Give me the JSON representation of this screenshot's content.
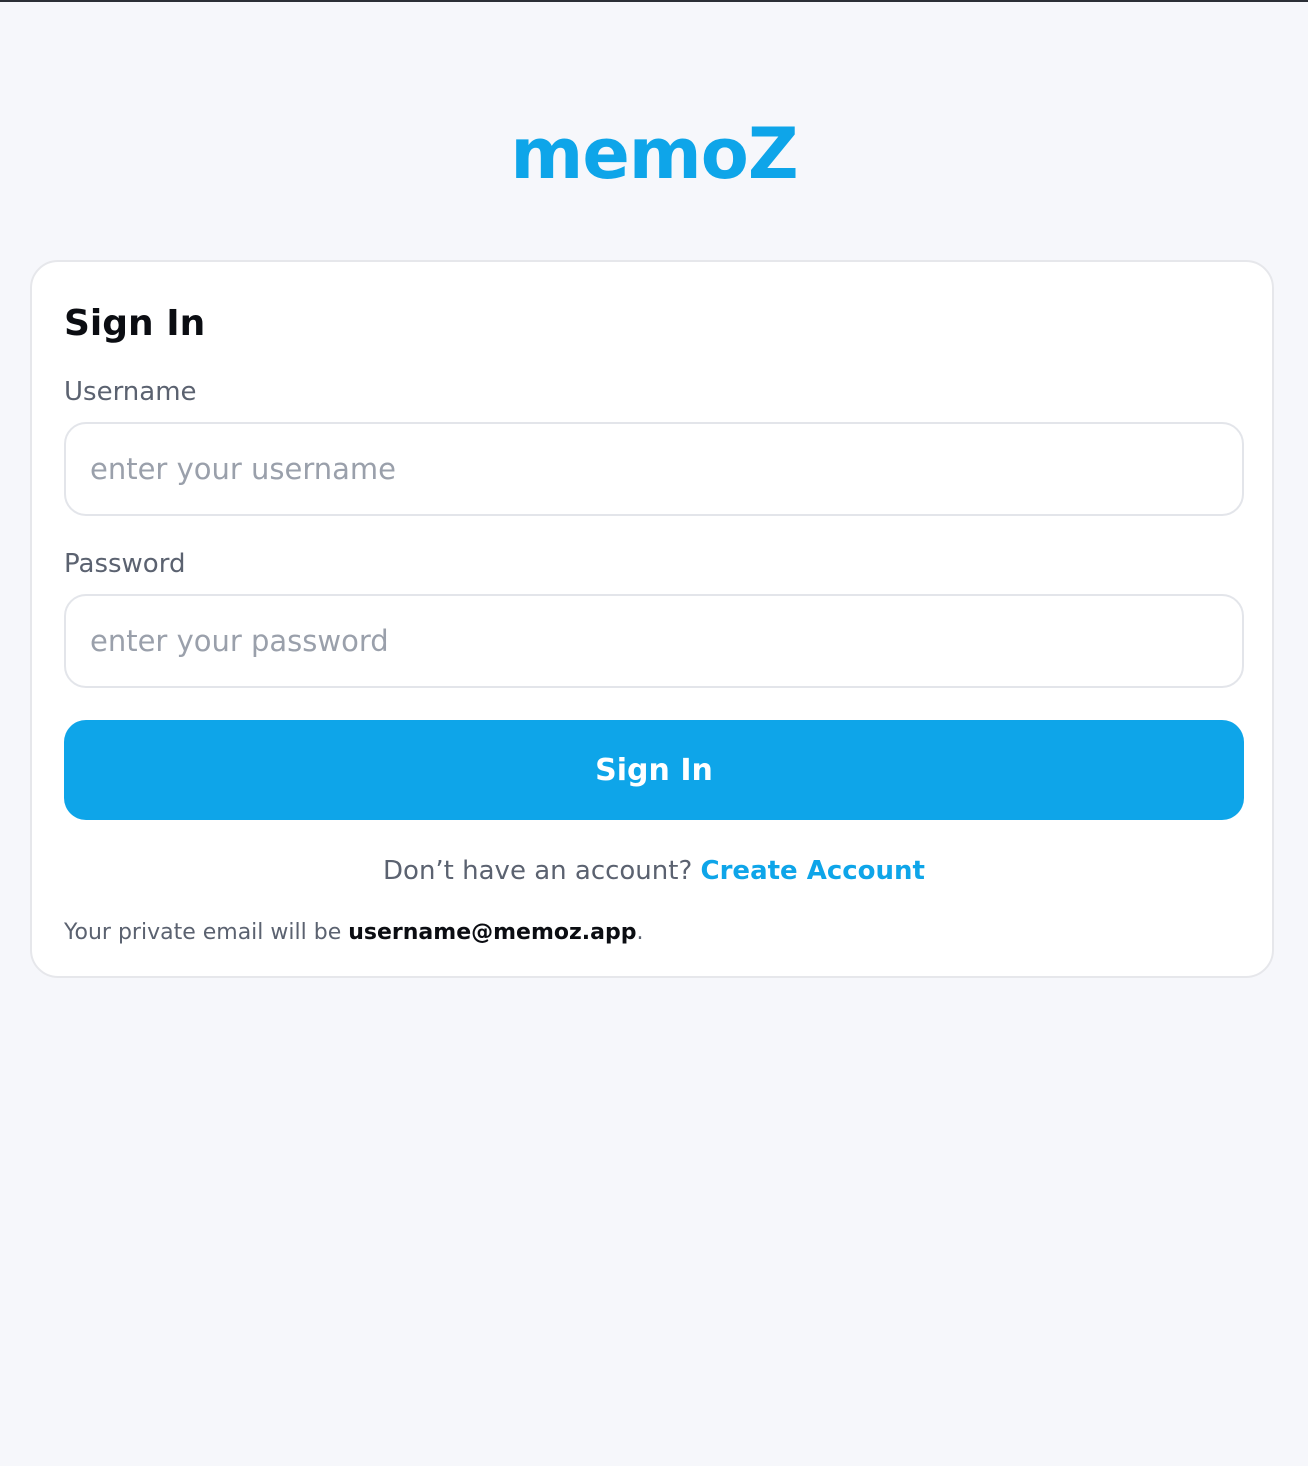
{
  "app": {
    "logo_text": "memoZ",
    "accent_color": "#0ea5e9"
  },
  "signin_card": {
    "title": "Sign In",
    "username": {
      "label": "Username",
      "placeholder": "enter your username",
      "value": ""
    },
    "password": {
      "label": "Password",
      "placeholder": "enter your password",
      "value": ""
    },
    "submit_label": "Sign In",
    "account_prompt": "Don’t have an account?",
    "create_account_label": "Create Account",
    "private_note_prefix": "Your private email will be",
    "private_email": "username@memoz.app",
    "private_note_suffix": "."
  }
}
